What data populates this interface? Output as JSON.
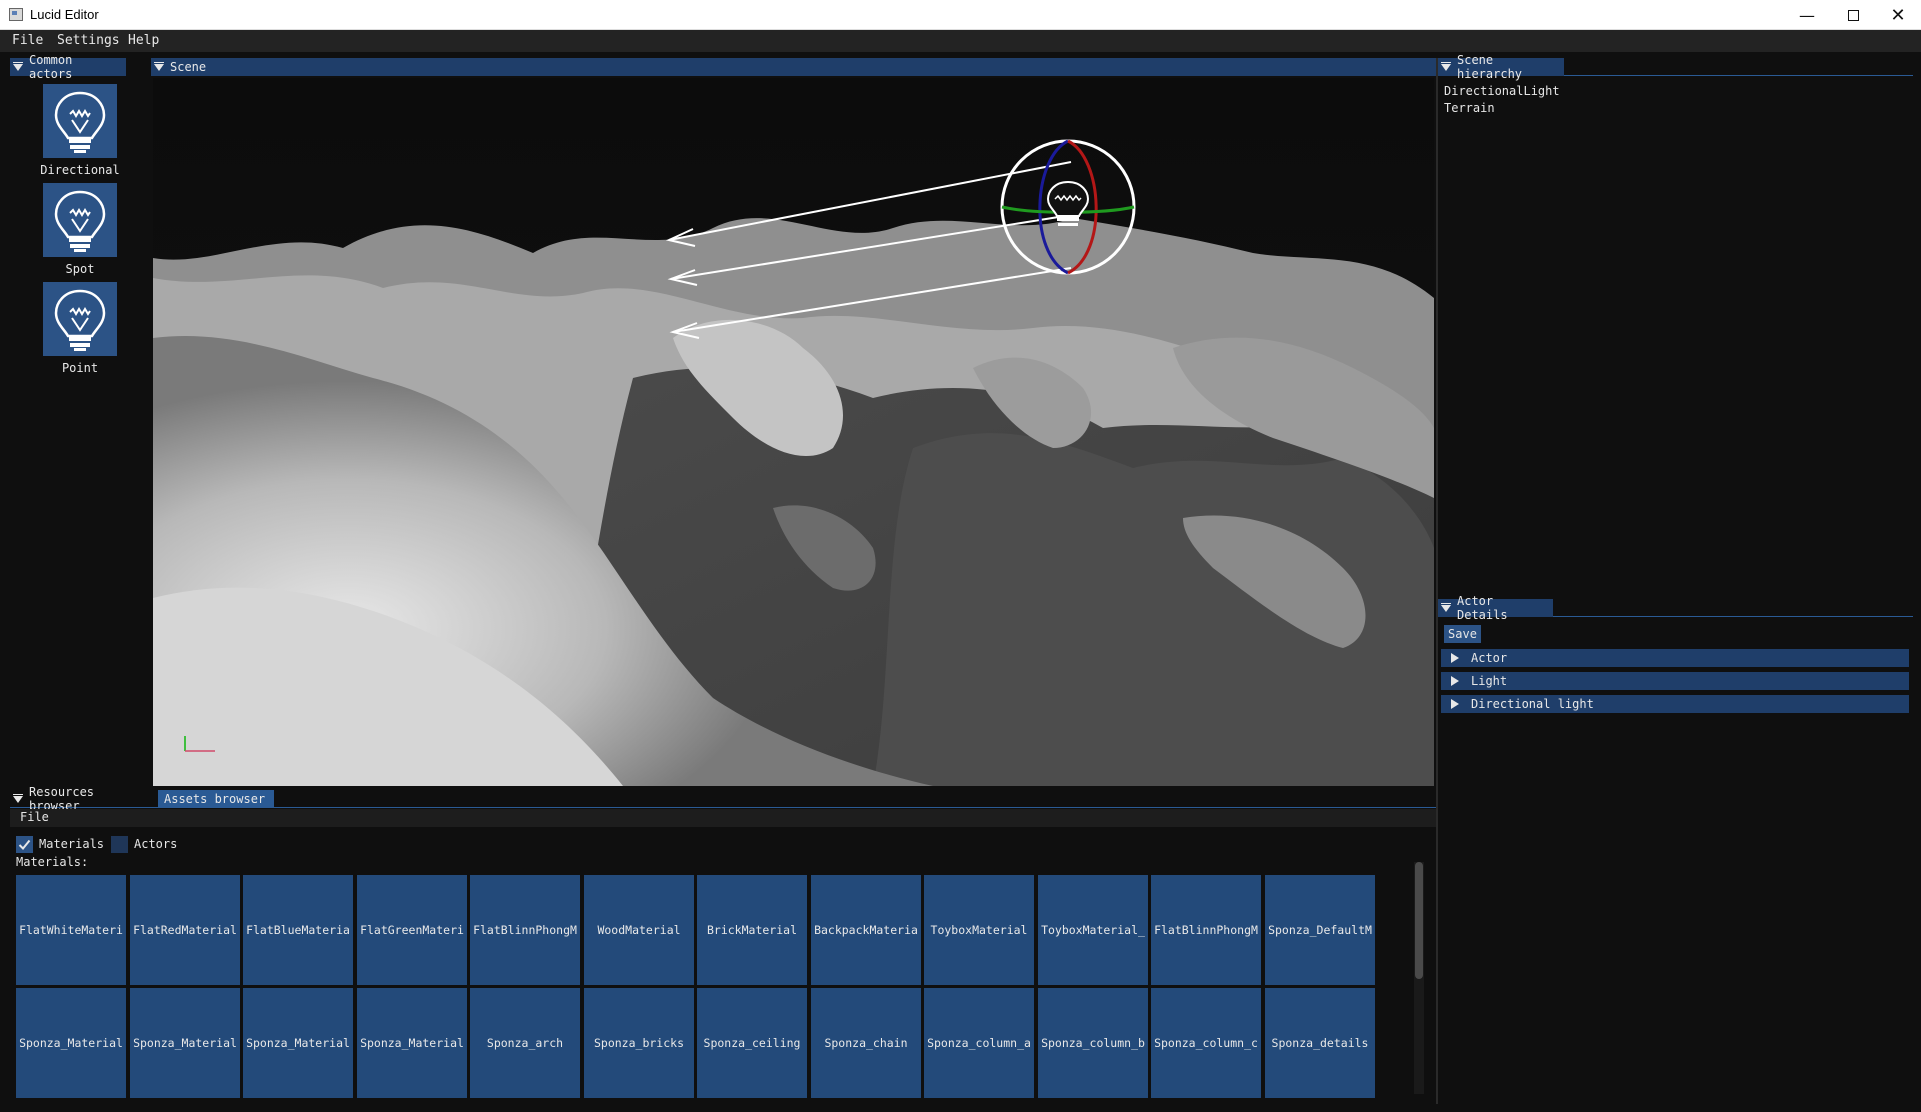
{
  "window": {
    "title": "Lucid Editor"
  },
  "menubar": {
    "items": [
      "File",
      "Settings",
      "Help"
    ]
  },
  "common_actors": {
    "tab_label": "Common actors",
    "items": [
      {
        "label": "Directional",
        "icon": "lightbulb-icon"
      },
      {
        "label": "Spot",
        "icon": "lightbulb-icon"
      },
      {
        "label": "Point",
        "icon": "lightbulb-icon"
      }
    ]
  },
  "scene": {
    "tab_label": "Scene"
  },
  "scene_hierarchy": {
    "tab_label": "Scene hierarchy",
    "items": [
      "DirectionalLight",
      "Terrain"
    ]
  },
  "actor_details": {
    "tab_label": "Actor Details",
    "save_label": "Save",
    "sections": [
      "Actor",
      "Light",
      "Directional light"
    ]
  },
  "bottom_panel": {
    "tabs": [
      "Resources browser",
      "Assets browser"
    ],
    "active_tab": "Assets browser",
    "file_menu": "File",
    "filters": [
      {
        "label": "Materials",
        "checked": true
      },
      {
        "label": "Actors",
        "checked": false
      }
    ],
    "section_label": "Materials:",
    "materials": [
      "FlatWhiteMateri",
      "FlatRedMaterial",
      "FlatBlueMateria",
      "FlatGreenMateri",
      "FlatBlinnPhongM",
      "WoodMaterial",
      "BrickMaterial",
      "BackpackMateria",
      "ToyboxMaterial",
      "ToyboxMaterial_",
      "FlatBlinnPhongM",
      "Sponza_DefaultM",
      "Sponza_Material",
      "Sponza_Material",
      "Sponza_Material",
      "Sponza_Material",
      "Sponza_arch",
      "Sponza_bricks",
      "Sponza_ceiling",
      "Sponza_chain",
      "Sponza_column_a",
      "Sponza_column_b",
      "Sponza_column_c",
      "Sponza_details"
    ]
  },
  "colors": {
    "accent": "#2c5386",
    "panel_bg": "#0f0f0f",
    "header_bg": "#1f3e6a",
    "tile_bg": "#234a7a"
  }
}
